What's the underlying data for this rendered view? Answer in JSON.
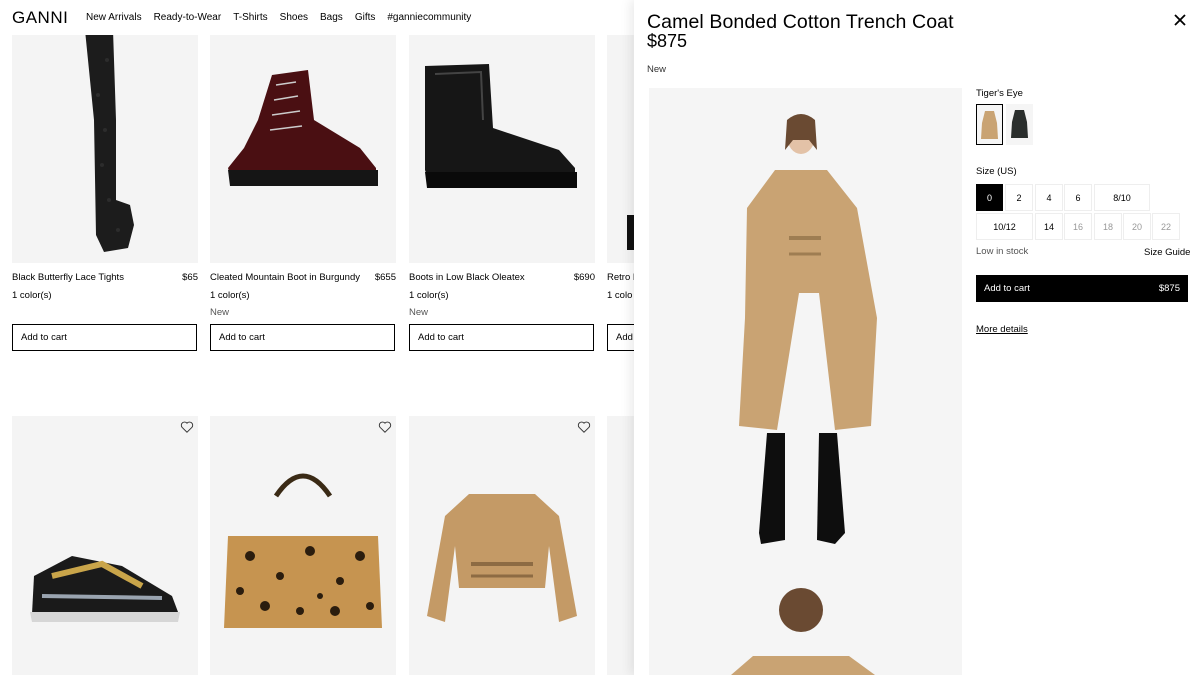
{
  "brand": "GANNI",
  "nav": [
    "New Arrivals",
    "Ready-to-Wear",
    "T-Shirts",
    "Shoes",
    "Bags",
    "Gifts",
    "#ganniecommunity"
  ],
  "products": [
    {
      "name": "Black Butterfly Lace Tights",
      "price": "$65",
      "colors": "1 color(s)",
      "badge": "",
      "button": "Add to cart"
    },
    {
      "name": "Cleated Mountain Boot in Burgundy",
      "price": "$655",
      "colors": "1 color(s)",
      "badge": "New",
      "button": "Add to cart"
    },
    {
      "name": "Boots in Low Black Oleatex",
      "price": "$690",
      "colors": "1 color(s)",
      "badge": "New",
      "button": "Add to cart"
    },
    {
      "name": "Retro R",
      "price": "",
      "colors": "1 colo",
      "badge": "",
      "button": "Add to"
    }
  ],
  "panel": {
    "title": "Camel Bonded Cotton Trench Coat",
    "price": "$875",
    "badge": "New",
    "color_label": "Tiger's Eye",
    "size_label": "Size (US)",
    "sizes": [
      {
        "label": "0",
        "state": "selected"
      },
      {
        "label": "2",
        "state": "available"
      },
      {
        "label": "4",
        "state": "available"
      },
      {
        "label": "6",
        "state": "available"
      },
      {
        "label": "8/10",
        "state": "available"
      },
      {
        "label": "10/12",
        "state": "available"
      },
      {
        "label": "14",
        "state": "available"
      },
      {
        "label": "16",
        "state": "unavailable"
      },
      {
        "label": "18",
        "state": "unavailable"
      },
      {
        "label": "20",
        "state": "unavailable"
      },
      {
        "label": "22",
        "state": "unavailable"
      }
    ],
    "stock": "Low in stock",
    "size_guide": "Size Guide",
    "add_to_cart": "Add to cart",
    "cart_price": "$875",
    "more_details": "More details"
  },
  "colors": {
    "camel": "#c9a373",
    "black": "#111111",
    "image_bg": "#f4f4f4"
  }
}
